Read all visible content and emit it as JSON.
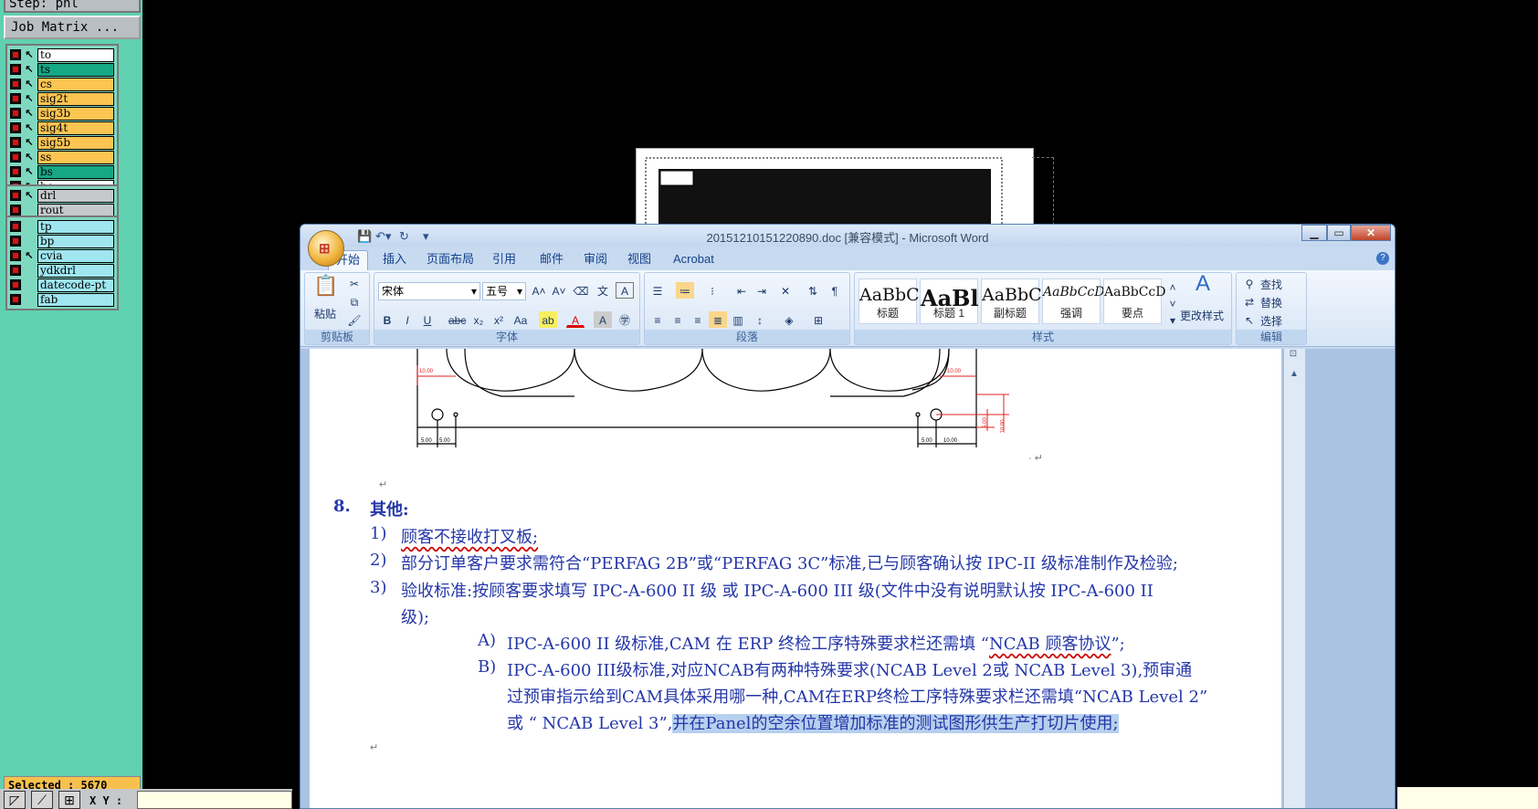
{
  "cam": {
    "step_label": "Step: pnl",
    "job_matrix_label": "Job Matrix ...",
    "groups": [
      {
        "layers": [
          {
            "name": "to",
            "color": "#ffffff",
            "arrow": "↖"
          },
          {
            "name": "ts",
            "color": "#16a885",
            "arrow": "↖"
          },
          {
            "name": "cs",
            "color": "#fcc552",
            "arrow": "↖"
          },
          {
            "name": "sig2t",
            "color": "#fcc552",
            "arrow": "↖"
          },
          {
            "name": "sig3b",
            "color": "#fcc552",
            "arrow": "↖"
          },
          {
            "name": "sig4t",
            "color": "#fcc552",
            "arrow": "↖"
          },
          {
            "name": "sig5b",
            "color": "#fcc552",
            "arrow": "↖"
          },
          {
            "name": "ss",
            "color": "#fcc552",
            "arrow": "↖"
          },
          {
            "name": "bs",
            "color": "#16a885",
            "arrow": "↖"
          },
          {
            "name": "bo",
            "color": "#ffffff",
            "arrow": "↖"
          }
        ]
      },
      {
        "layers": [
          {
            "name": "drl",
            "color": "#c6c9cb",
            "arrow": "↖"
          },
          {
            "name": "rout",
            "color": "#c6c9cb",
            "arrow": ""
          }
        ]
      },
      {
        "layers": [
          {
            "name": "tp",
            "color": "#9fe6f0",
            "arrow": ""
          },
          {
            "name": "bp",
            "color": "#9fe6f0",
            "arrow": ""
          },
          {
            "name": "cvia",
            "color": "#9fe6f0",
            "arrow": "↖"
          },
          {
            "name": "ydkdrl",
            "color": "#9fe6f0",
            "arrow": ""
          },
          {
            "name": "datecode-pt",
            "color": "#9fe6f0",
            "arrow": ""
          },
          {
            "name": "fab",
            "color": "#9fe6f0",
            "arrow": ""
          }
        ]
      }
    ],
    "selected_label": "Selected : 5670",
    "xy_label": "X Y :"
  },
  "word": {
    "title": "20151210151220890.doc [兼容模式] - Microsoft Word",
    "office_logo": "⊞",
    "tabs": [
      "开始",
      "插入",
      "页面布局",
      "引用",
      "邮件",
      "审阅",
      "视图",
      "Acrobat"
    ],
    "active_tab": "开始",
    "ribbon": {
      "clipboard": {
        "paste": "粘贴",
        "label": "剪贴板"
      },
      "font": {
        "name": "宋体",
        "size": "五号",
        "label": "字体"
      },
      "paragraph": {
        "label": "段落"
      },
      "styles": {
        "label": "样式",
        "items": [
          {
            "sample": "AaBbC",
            "name": "标题"
          },
          {
            "sample": "AaBl",
            "name": "标题 1"
          },
          {
            "sample": "AaBbC",
            "name": "副标题"
          },
          {
            "sample": "AaBbCcD",
            "name": "强调"
          },
          {
            "sample": "AaBbCcD",
            "name": "要点"
          }
        ],
        "change": "更改样式"
      },
      "editing": {
        "find": "查找",
        "replace": "替换",
        "select": "选择",
        "label": "编辑"
      }
    },
    "drawing": {
      "dims": [
        "10.00",
        "10.00",
        "5.00",
        "5.00",
        "5.00",
        "10.00",
        "5.00",
        "10.00"
      ]
    },
    "document": {
      "section_number": "8.",
      "section_title": "其他:",
      "items": [
        {
          "num": "1)",
          "text": "顾客不接收打叉板;"
        },
        {
          "num": "2)",
          "text": "部分订单客户要求需符合“PERFAG 2B”或“PERFAG 3C”标准,已与顾客确认按 IPC-II 级标准制作及检验;"
        },
        {
          "num": "3)",
          "text": "验收标准:按顾客要求填写 IPC-A-600 II 级 或 IPC-A-600 III 级(文件中没有说明默认按 IPC-A-600 II",
          "cont": "级);"
        }
      ],
      "subitems": [
        {
          "num": "A)",
          "text_pre": "IPC-A-600 II 级标准,CAM 在 ERP 终检工序特殊要求栏还需填 “",
          "text_ul": "NCAB 顾客协议",
          "text_post": "”;"
        },
        {
          "num": "B)",
          "line1": "IPC-A-600 III级标准,对应NCAB有两种特殊要求(NCAB Level 2或 NCAB Level 3),预审通",
          "line2": "过预审指示给到CAM具体采用哪一种,CAM在ERP终检工序特殊要求栏还需填“NCAB Level 2”",
          "line3_pre": "或 “ NCAB Level 3”,",
          "line3_hl": "并在Panel的空余位置增加标准的测试图形供生产打切片使用;"
        }
      ]
    }
  }
}
